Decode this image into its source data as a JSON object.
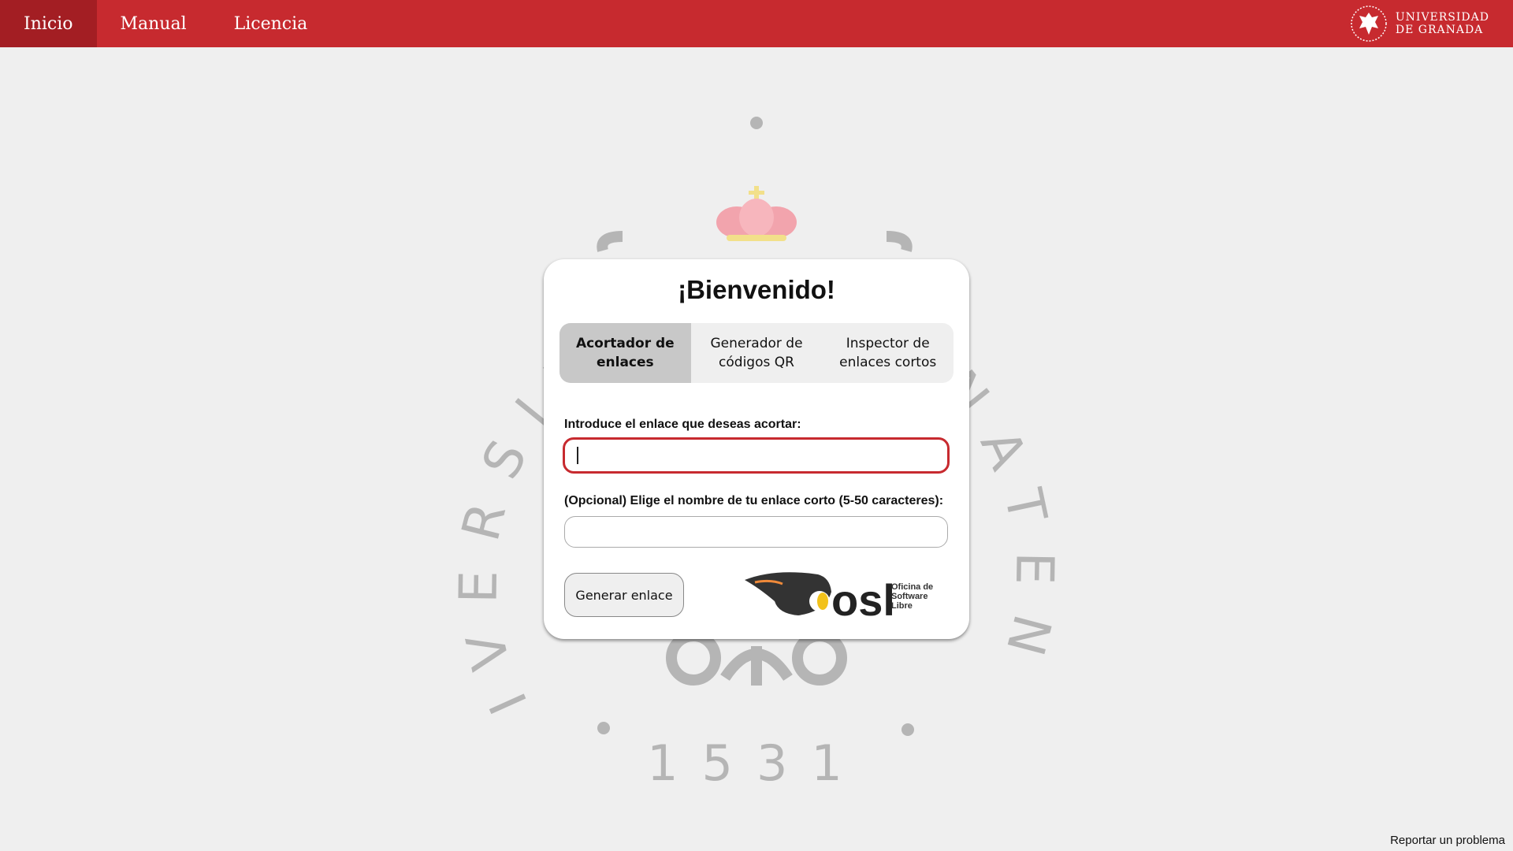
{
  "nav": {
    "items": [
      {
        "label": "Inicio",
        "active": true
      },
      {
        "label": "Manual",
        "active": false
      },
      {
        "label": "Licencia",
        "active": false
      }
    ]
  },
  "brand": {
    "line1": "UNIVERSIDAD",
    "line2": "DE GRANADA",
    "icon": "university-crest-icon"
  },
  "seal": {
    "arc_text": "UNIVERSITAS GRANATENSIS",
    "year": "1531",
    "colors": {
      "text": "#b5b5b5",
      "crown": "#f2a4ad",
      "crown_jewels": "#f2e08a"
    }
  },
  "card": {
    "title": "¡Bienvenido!",
    "tabs": [
      {
        "label": "Acortador de enlaces",
        "active": true
      },
      {
        "label": "Generador de códigos QR",
        "active": false
      },
      {
        "label": "Inspector de enlaces cortos",
        "active": false
      }
    ],
    "url_field": {
      "label": "Introduce el enlace que deseas acortar:",
      "value": "",
      "placeholder": ""
    },
    "alias_field": {
      "label": "(Opcional) Elige el nombre de tu enlace corto (5-50 caracteres):",
      "value": "",
      "placeholder": ""
    },
    "submit_label": "Generar enlace",
    "logo": {
      "wordmark": "osl",
      "line1": "Oficina de",
      "line2": "Software",
      "line3": "Libre"
    }
  },
  "footer": {
    "report_label": "Reportar un problema"
  },
  "colors": {
    "accent": "#c72a2f",
    "accent_dark": "#a31e23",
    "background": "#efefef"
  }
}
